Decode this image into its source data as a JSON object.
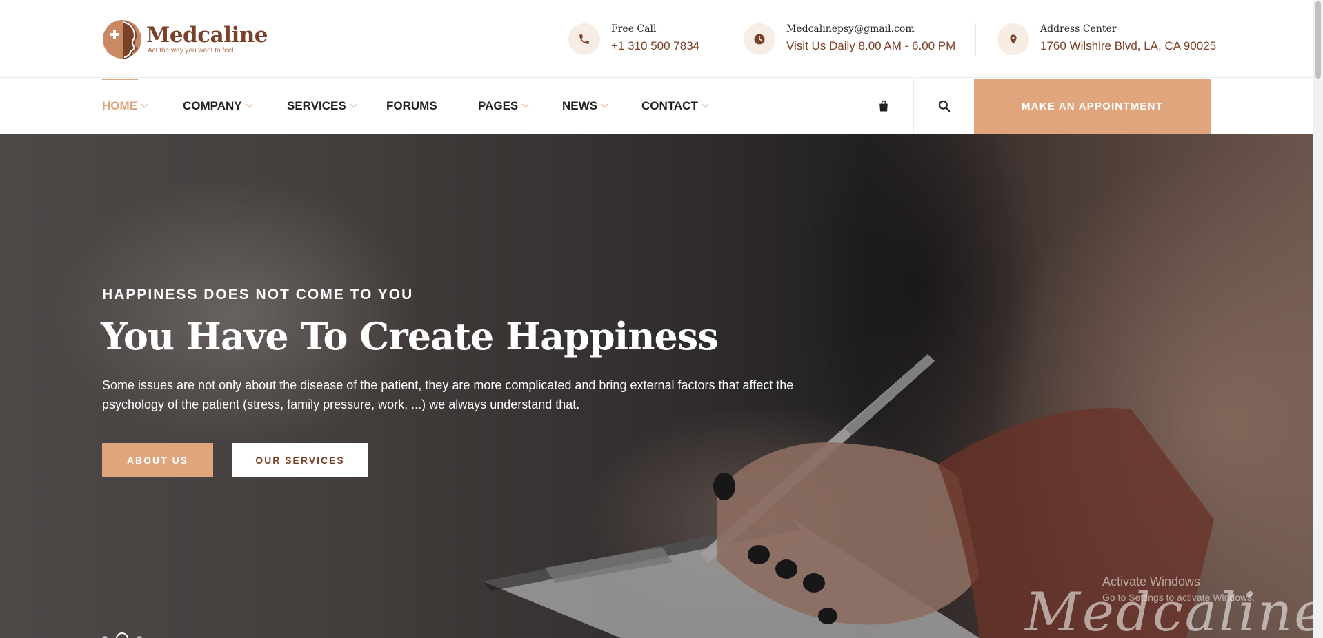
{
  "brand": {
    "name": "Medcaline",
    "tagline": "Act the way you want to feel.",
    "accent": "#e0a57c",
    "brand_brown": "#7a4128"
  },
  "contacts": [
    {
      "icon": "phone-icon",
      "label": "Free Call",
      "value": "+1 310 500 7834"
    },
    {
      "icon": "clock-icon",
      "label": "Medcalinepsy@gmail.com",
      "value": "Visit Us Daily 8.00 AM - 6.00 PM"
    },
    {
      "icon": "location-icon",
      "label": "Address Center",
      "value": "1760 Wilshire Blvd, LA, CA 90025"
    }
  ],
  "nav": {
    "items": [
      {
        "label": "HOME",
        "dropdown": true,
        "active": true
      },
      {
        "label": "COMPANY",
        "dropdown": true
      },
      {
        "label": "SERVICES",
        "dropdown": true
      },
      {
        "label": "FORUMS",
        "dropdown": false
      },
      {
        "label": "PAGES",
        "dropdown": true
      },
      {
        "label": "NEWS",
        "dropdown": true
      },
      {
        "label": "CONTACT",
        "dropdown": true
      }
    ],
    "tools": [
      "cart-icon",
      "search-icon"
    ],
    "cta": "MAKE AN APPOINTMENT"
  },
  "hero": {
    "subtitle": "HAPPINESS DOES NOT COME TO YOU",
    "title": "You Have To Create Happiness",
    "description": "Some issues are not only about the disease of the patient, they are more complicated and bring external factors that affect the psychology of the patient (stress, family pressure, work, ...) we always understand that.",
    "buttons": {
      "primary": "ABOUT US",
      "secondary": "OUR SERVICES"
    },
    "script_signature": "Medcaline",
    "slides_active": 2
  },
  "os_watermark": {
    "line1": "Activate Windows",
    "line2": "Go to Settings to activate Windows."
  }
}
